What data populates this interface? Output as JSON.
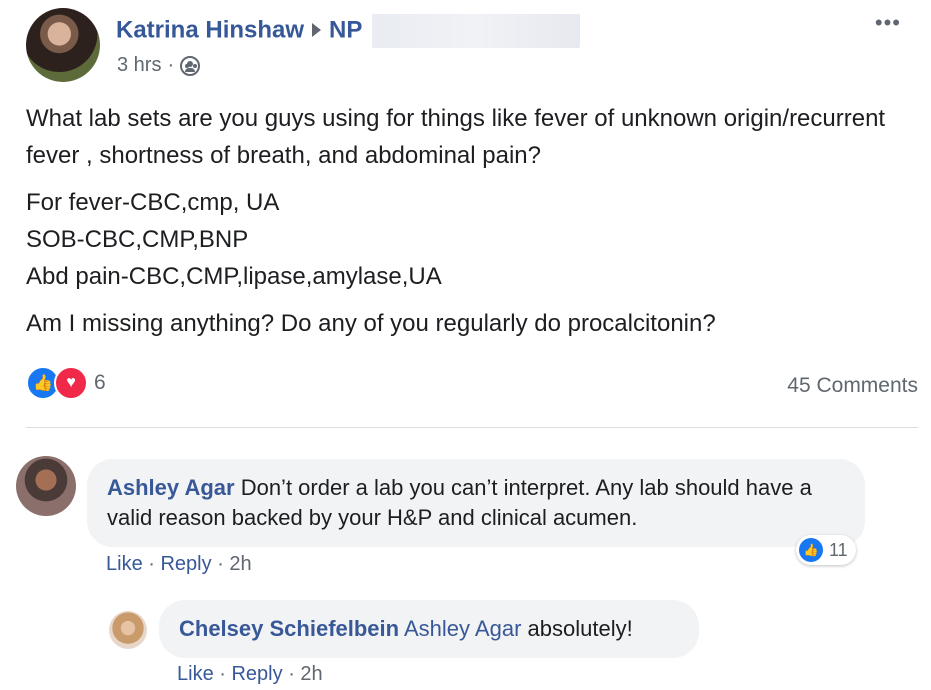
{
  "post": {
    "author": "Katrina Hinshaw",
    "group_prefix": "NP",
    "time": "3 hrs",
    "paragraph1": "What lab sets are you guys using for things like fever of unknown origin/recurrent fever , shortness of breath, and abdominal pain?",
    "list": [
      "For fever-CBC,cmp, UA",
      "SOB-CBC,CMP,BNP",
      "Abd pain-CBC,CMP,lipase,amylase,UA"
    ],
    "paragraph3": "Am I missing anything? Do any of you regularly do procalcitonin?",
    "reaction_count": "6",
    "comments_label": "45 Comments",
    "more_icon": "more-horizontal-icon",
    "privacy_icon": "group-icon"
  },
  "comments": [
    {
      "author": "Ashley Agar",
      "text": "Don’t order a lab you can’t interpret. Any lab should have a valid reason backed by your H&P and clinical acumen.",
      "like_label": "Like",
      "reply_label": "Reply",
      "time": "2h",
      "like_count": "11"
    },
    {
      "author": "Chelsey Schiefelbein",
      "mention": "Ashley Agar",
      "text": "absolutely!",
      "like_label": "Like",
      "reply_label": "Reply",
      "time": "2h"
    }
  ],
  "colors": {
    "link_blue": "#365899",
    "meta_gray": "#606770",
    "bubble_bg": "#f2f3f5",
    "like_blue": "#1877f2",
    "love_red": "#f0284a"
  }
}
